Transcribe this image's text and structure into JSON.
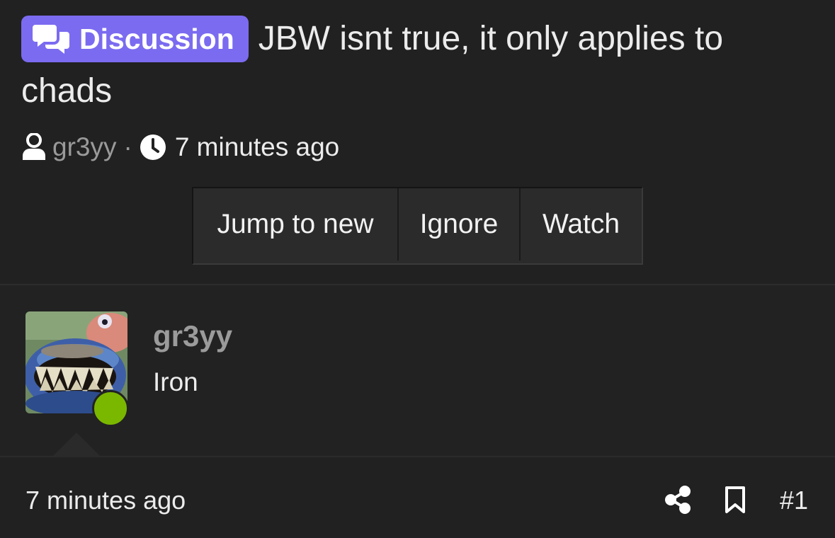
{
  "thread": {
    "prefix_label": "Discussion",
    "prefix_color": "#7b6bf0",
    "title": "JBW isnt true, it only applies to chads",
    "author": "gr3yy",
    "separator": "·",
    "time": "7 minutes ago"
  },
  "actions": {
    "jump_label": "Jump to new",
    "ignore_label": "Ignore",
    "watch_label": "Watch"
  },
  "post": {
    "author": "gr3yy",
    "body": "Iron",
    "online_color": "#7ab800",
    "time": "7 minutes ago",
    "number": "#1"
  },
  "icons": {
    "prefix": "comments-icon",
    "author": "user-icon",
    "time": "clock-icon",
    "share": "share-icon",
    "bookmark": "bookmark-icon"
  }
}
